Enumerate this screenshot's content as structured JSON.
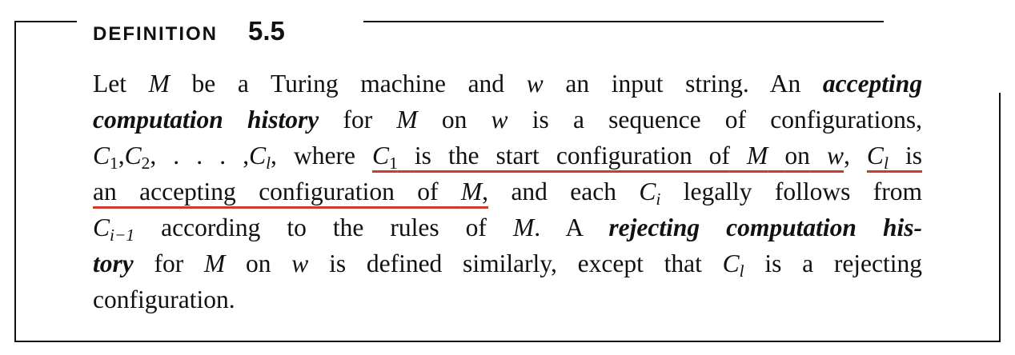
{
  "heading": {
    "word": "DEFINITION",
    "number": "5.5"
  },
  "definition": {
    "line1": {
      "let": "Let",
      "M": "M",
      "be_tm": "be a Turing machine and",
      "w": "w",
      "input": "an input string.  An",
      "term": "accepting"
    },
    "line2": {
      "term": "computation history",
      "for": "for",
      "M": "M",
      "on": "on",
      "w": "w",
      "rest": "is a sequence of configurations,"
    },
    "line3": {
      "C": "C",
      "sub1": "1",
      "c1": ",",
      "sub2": "2",
      "ellipsis": ", . . . ,",
      "subl": "l",
      "where": ", where",
      "start_C": "C",
      "start_sub": "1",
      "start_text": "is the start configuration of",
      "start_M": "M",
      "start_on": "on",
      "start_w": "w",
      "comma": ",",
      "acc_C": "C",
      "acc_sub": "l",
      "acc_is": "is"
    },
    "line4": {
      "acc_text": "an accepting configuration of",
      "acc_M": "M",
      "acc_comma": ",",
      "and_each": "and each",
      "Ci": "C",
      "sub_i": "i",
      "rest": "legally follows from"
    },
    "line5": {
      "C": "C",
      "sub": "i−1",
      "according": "according to the rules of",
      "M": "M",
      "period": ".  A",
      "term": "rejecting computation his-"
    },
    "line6": {
      "term": "tory",
      "for": "for",
      "M": "M",
      "on": "on",
      "w": "w",
      "defined": "is defined similarly, except that",
      "C": "C",
      "sub": "l",
      "rest": "is a rejecting"
    },
    "line7": {
      "text": "configuration."
    }
  }
}
